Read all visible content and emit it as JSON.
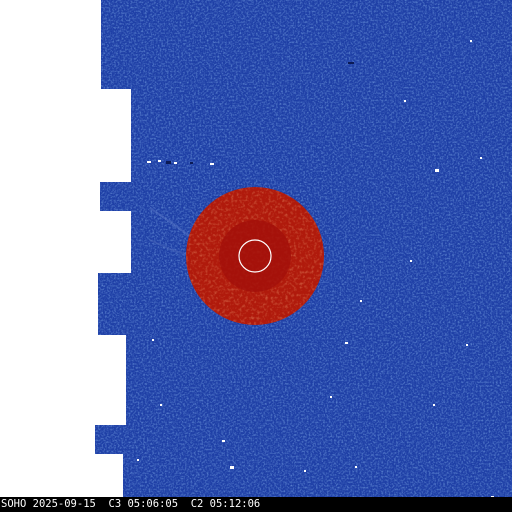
{
  "caption": {
    "observatory": "SOHO",
    "date": "2025-09-15",
    "c3_time": "C3 05:06:05",
    "c2_time": "C2 05:12:06"
  },
  "colors": {
    "c3_field": "#1e3fa6",
    "c2_disk": "#b01a0c",
    "occulter": "#a3110a",
    "sun_outline": "#ffffff",
    "missing_blocks": "#ffffff",
    "caption_bg": "#000000",
    "caption_text": "#ffffff"
  }
}
